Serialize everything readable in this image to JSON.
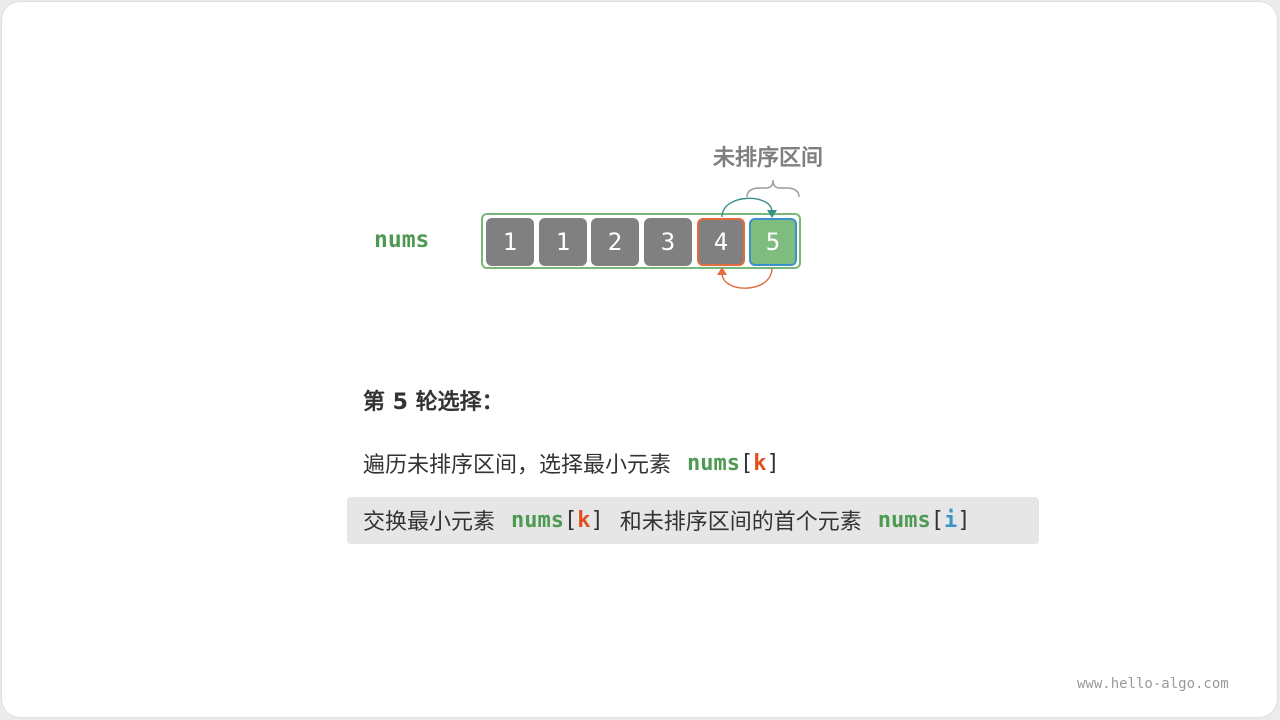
{
  "diagram": {
    "array_label": "nums",
    "range_label": "未排序区间",
    "cells": [
      {
        "value": "1",
        "state": "sorted"
      },
      {
        "value": "1",
        "state": "sorted"
      },
      {
        "value": "2",
        "state": "sorted"
      },
      {
        "value": "3",
        "state": "sorted"
      },
      {
        "value": "4",
        "state": "first-unsorted"
      },
      {
        "value": "5",
        "state": "min"
      }
    ],
    "colors": {
      "sorted": "#808080",
      "min_fill": "#7fbd7f",
      "index_i": "#e46c3c",
      "index_k": "#3c92c8",
      "frame": "#77b878",
      "arrow_top": "#3a8f8a",
      "arrow_bottom": "#e46c3c"
    }
  },
  "text": {
    "step_title": "第 5 轮选择：",
    "line1": {
      "prefix": "遍历未排序区间，选择最小元素",
      "var": "nums",
      "open": "[",
      "idx": "k",
      "close": "]"
    },
    "line2": {
      "prefix": "交换最小元素",
      "var1": "nums",
      "open1": "[",
      "idx1": "k",
      "close1": "]",
      "middle": "和未排序区间的首个元素",
      "var2": "nums",
      "open2": "[",
      "idx2": "i",
      "close2": "]"
    }
  },
  "watermark": "www.hello-algo.com"
}
